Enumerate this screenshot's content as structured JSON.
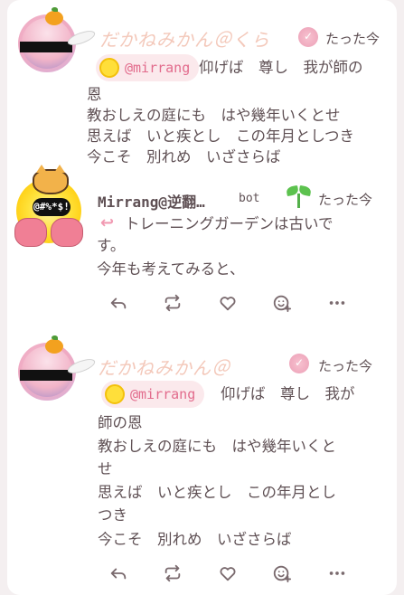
{
  "notes": [
    {
      "author_name": "だかねみかん＠くら",
      "time": "たった今",
      "mention": "@mirrang",
      "text_lines": [
        "仰げば　尊し　我が師の",
        "恩",
        "教おしえの庭にも　はや幾年いくとせ",
        "思えば　いと疾とし　この年月としつき",
        "今こそ　別れめ　いざさらば"
      ]
    },
    {
      "author_name": "Mirrang@逆翻…",
      "bot_label": "bot",
      "avatar_speech": "@#%*$!",
      "time": "たった今",
      "reply_mark": "↩",
      "text_lines": [
        "トレーニングガーデンは古いで",
        "す。",
        "今年も考えてみると、"
      ]
    },
    {
      "author_name": "だかねみかん＠",
      "time": "たった今",
      "mention": "@mirrang",
      "text_lines": [
        "仰げば　尊し　我が",
        "師の恩",
        "教おしえの庭にも　はや幾年いくと",
        "せ",
        "思えば　いと疾とし　この年月とし",
        "つき",
        "今こそ　別れめ　いざさらば"
      ]
    }
  ],
  "actions": [
    "reply-icon",
    "renote-icon",
    "heart-icon",
    "emoji-reaction-icon",
    "more-icon"
  ],
  "colors": {
    "accent_pink": "#e26b8c",
    "text": "#5f5054",
    "action_icon": "#7a6a6e"
  }
}
